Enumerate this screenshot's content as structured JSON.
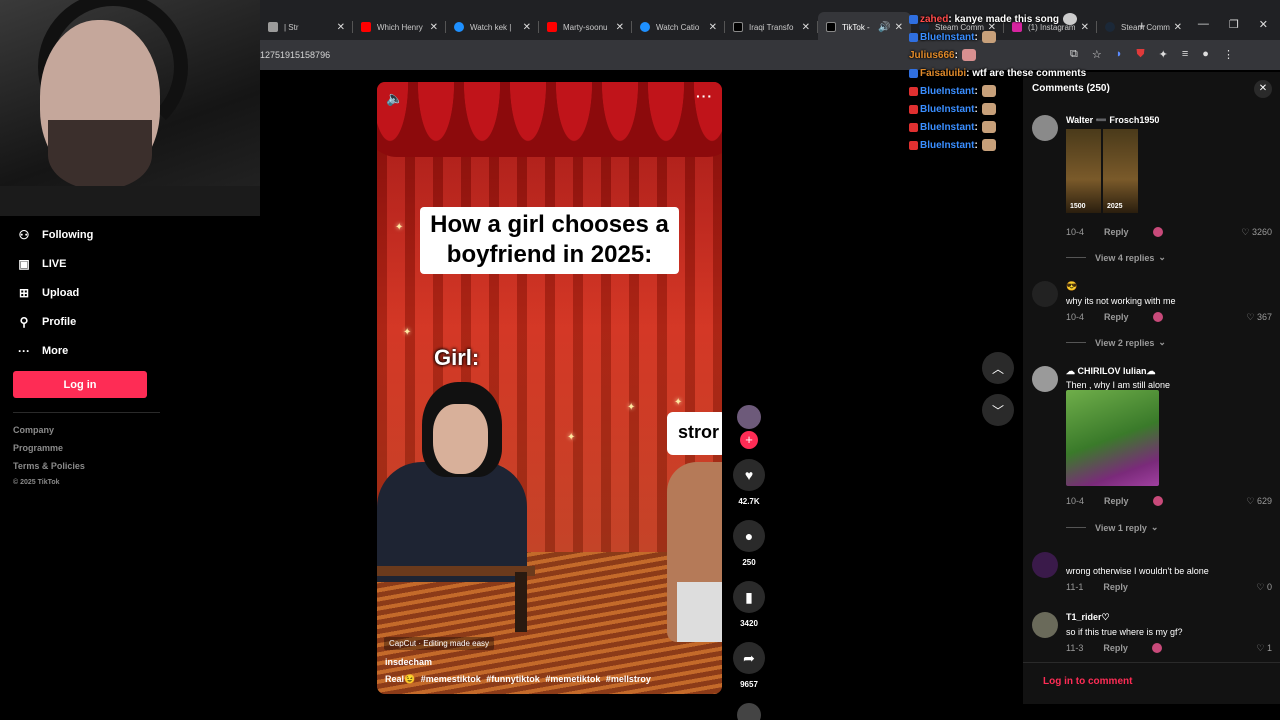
{
  "browser": {
    "tabs": [
      {
        "title": "| Str",
        "color": "#9b9b9b"
      },
      {
        "title": "Which Henry",
        "color": "#ff0000"
      },
      {
        "title": "Watch kek |",
        "color": "#1e90ff"
      },
      {
        "title": "Marty-soonu",
        "color": "#ff0000"
      },
      {
        "title": "Watch Catio",
        "color": "#1e90ff"
      },
      {
        "title": "Iraqi Transfo",
        "color": "#000000"
      },
      {
        "title": "TikTok -",
        "color": "#000000",
        "active": true
      },
      {
        "title": "Steam Comm",
        "color": "#1b2838"
      },
      {
        "title": "(1) Instagram",
        "color": "#d6249f"
      },
      {
        "title": "Steam Comm",
        "color": "#1b2838"
      }
    ],
    "url": "12751915158796"
  },
  "sidebar": {
    "items": [
      {
        "label": "Following",
        "icon": "user-follow-icon"
      },
      {
        "label": "LIVE",
        "icon": "live-tv-icon"
      },
      {
        "label": "Upload",
        "icon": "plus-square-icon"
      },
      {
        "label": "Profile",
        "icon": "person-icon"
      },
      {
        "label": "More",
        "icon": "more-dots-icon"
      }
    ],
    "login_label": "Log in",
    "footer": [
      "Company",
      "Programme",
      "Terms & Policies"
    ],
    "copyright": "© 2025 TikTok"
  },
  "video": {
    "caption": "How a girl chooses a boyfriend in 2025:",
    "girl_label": "Girl:",
    "strong_label": "stror",
    "capcut": "CapCut · Editing made easy",
    "author": "insdecham",
    "description_prefix": "Real😉",
    "hashtags": [
      "#memestiktok",
      "#funnytiktok",
      "#memetiktok",
      "#mellstroy"
    ],
    "likes": "42.7K",
    "comments": "250",
    "saves": "3420",
    "shares": "9657"
  },
  "chat": [
    {
      "user": "zahed",
      "user_color": "#ff4a4a",
      "msg": ": kanye made this song",
      "badge": "blue"
    },
    {
      "user": "BlueInstant",
      "user_color": "#3a8eff",
      "msg": " :",
      "badge": "blue"
    },
    {
      "user": "Julius666",
      "user_color": "#e08a2a",
      "msg": " :",
      "badge": ""
    },
    {
      "user": "Faisaluibi",
      "user_color": "#e08a2a",
      "msg": ": wtf are these comments",
      "badge": "blue"
    },
    {
      "user": "BlueInstant",
      "user_color": "#3a8eff",
      "msg": " :",
      "badge": "red"
    },
    {
      "user": "BlueInstant",
      "user_color": "#3a8eff",
      "msg": " :",
      "badge": "red"
    },
    {
      "user": "BlueInstant",
      "user_color": "#3a8eff",
      "msg": " :",
      "badge": "red"
    },
    {
      "user": "BlueInstant",
      "user_color": "#3a8eff",
      "msg": " :",
      "badge": "red"
    }
  ],
  "comments_panel": {
    "title": "Comments (250)",
    "items": [
      {
        "user": "Walter ➖ Frosch1950",
        "date": "10-4",
        "reply": "Reply",
        "likes": "3260",
        "views": "View 4 replies",
        "img_left": "1500",
        "img_right": "2025"
      },
      {
        "user": "😎",
        "text": "why its not working with me",
        "date": "10-4",
        "reply": "Reply",
        "likes": "367",
        "views": "View 2 replies"
      },
      {
        "user": "☁ CHIRILOV Iulian☁",
        "text": "Then , why I am still alone",
        "date": "10-4",
        "reply": "Reply",
        "likes": "629",
        "views": "View 1 reply"
      },
      {
        "user": "",
        "text": "wrong otherwise I wouldn't be alone",
        "date": "11-1",
        "reply": "Reply",
        "likes": "0"
      },
      {
        "user": "T1_rider♡",
        "text": "so if this true where is my gf?",
        "date": "11-3",
        "reply": "Reply",
        "likes": "1"
      }
    ],
    "login_link": "Log in to comment"
  },
  "colors": {
    "accent": "#fe2c55",
    "panel": "#121212"
  }
}
